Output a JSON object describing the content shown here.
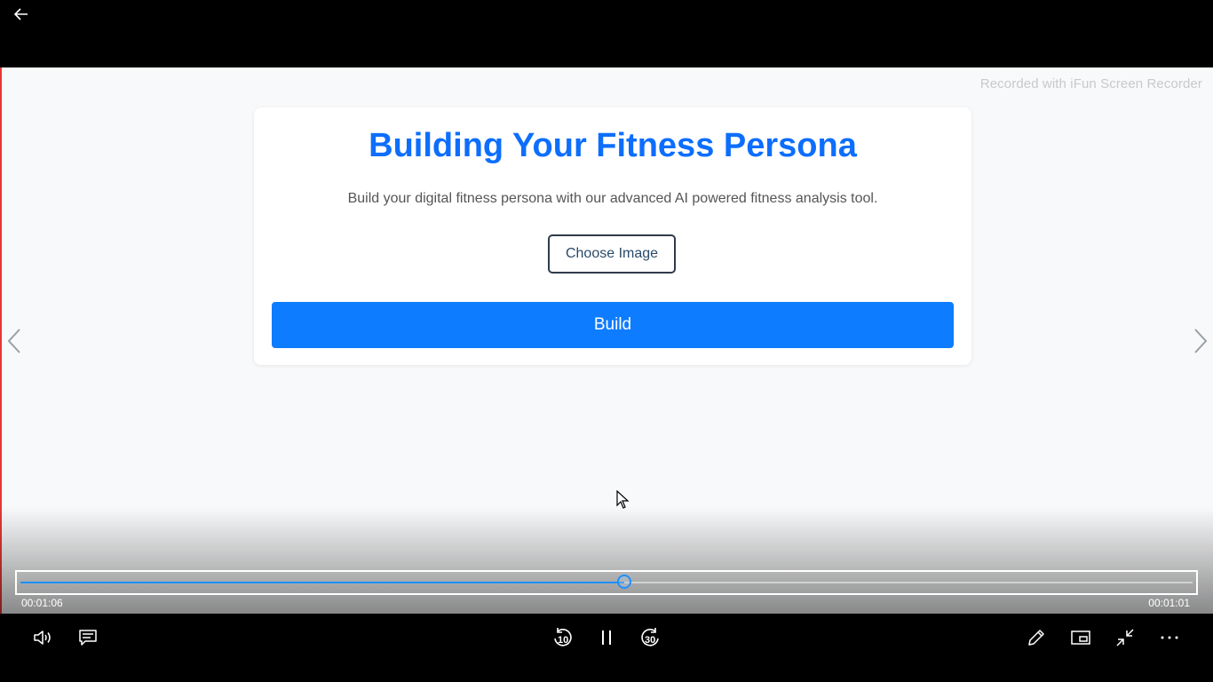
{
  "player": {
    "watermark": "Recorded with iFun Screen Recorder",
    "elapsed": "00:01:06",
    "remaining": "00:01:01",
    "progress_fraction": 0.515,
    "skip_back_seconds": "10",
    "skip_forward_seconds": "30"
  },
  "card": {
    "title": "Building Your Fitness Persona",
    "description": "Build your digital fitness persona with our advanced AI powered fitness analysis tool.",
    "choose_button": "Choose Image",
    "build_button": "Build"
  },
  "colors": {
    "accent": "#0d6efd",
    "build_button": "#0d7cff",
    "seek_fill": "#1e90ff"
  },
  "icons": [
    "back-arrow-icon",
    "chevron-left-icon",
    "chevron-right-icon",
    "mouse-cursor-icon",
    "volume-icon",
    "subtitles-icon",
    "skip-back-icon",
    "pause-icon",
    "skip-forward-icon",
    "edit-pen-icon",
    "mini-view-icon",
    "exit-fullscreen-icon",
    "more-options-icon"
  ]
}
